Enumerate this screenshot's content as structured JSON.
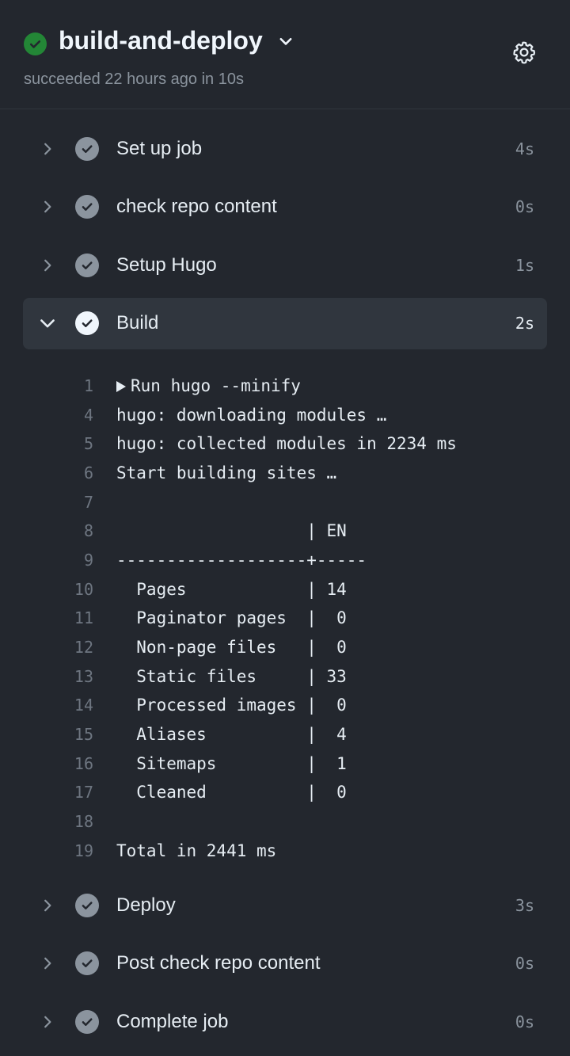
{
  "workflow": {
    "title": "build-and-deploy",
    "subtitle": "succeeded 22 hours ago in 10s",
    "status_color": "#238636"
  },
  "steps_before": [
    {
      "label": "Set up job",
      "duration": "4s"
    },
    {
      "label": "check repo content",
      "duration": "0s"
    },
    {
      "label": "Setup Hugo",
      "duration": "1s"
    }
  ],
  "active_step": {
    "label": "Build",
    "duration": "2s"
  },
  "log": [
    {
      "num": "1",
      "text": "Run hugo --minify",
      "collapsible": true
    },
    {
      "num": "4",
      "text": "hugo: downloading modules …"
    },
    {
      "num": "5",
      "text": "hugo: collected modules in 2234 ms"
    },
    {
      "num": "6",
      "text": "Start building sites …"
    },
    {
      "num": "7",
      "text": ""
    },
    {
      "num": "8",
      "text": "                   | EN"
    },
    {
      "num": "9",
      "text": "-------------------+-----"
    },
    {
      "num": "10",
      "text": "  Pages            | 14"
    },
    {
      "num": "11",
      "text": "  Paginator pages  |  0"
    },
    {
      "num": "12",
      "text": "  Non-page files   |  0"
    },
    {
      "num": "13",
      "text": "  Static files     | 33"
    },
    {
      "num": "14",
      "text": "  Processed images |  0"
    },
    {
      "num": "15",
      "text": "  Aliases          |  4"
    },
    {
      "num": "16",
      "text": "  Sitemaps         |  1"
    },
    {
      "num": "17",
      "text": "  Cleaned          |  0"
    },
    {
      "num": "18",
      "text": ""
    },
    {
      "num": "19",
      "text": "Total in 2441 ms"
    }
  ],
  "steps_after": [
    {
      "label": "Deploy",
      "duration": "3s"
    },
    {
      "label": "Post check repo content",
      "duration": "0s"
    },
    {
      "label": "Complete job",
      "duration": "0s"
    }
  ]
}
